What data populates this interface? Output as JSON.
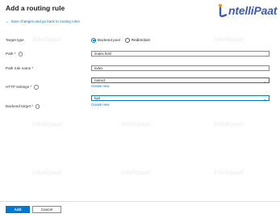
{
  "header": {
    "title": "Add a routing rule",
    "back_link": "Save changes and go back to routing rules"
  },
  "brand": {
    "text": "ntelliPaat",
    "watermark": "Intellipaat"
  },
  "form": {
    "target_type": {
      "label": "Target type",
      "options": [
        "Backend pool",
        "Redirection"
      ],
      "selected": "Backend pool"
    },
    "path": {
      "label": "Path *",
      "value": "/index.html"
    },
    "path_rule_name": {
      "label": "Path rule name *",
      "value": "index"
    },
    "http_settings": {
      "label": "HTTP settings *",
      "value": "name2",
      "create_new": "Create new"
    },
    "backend_target": {
      "label": "Backend target *",
      "value": "bp2",
      "create_new": "Create new"
    }
  },
  "footer": {
    "add": "Add",
    "cancel": "Cancel"
  },
  "colors": {
    "accent": "#0078d4",
    "brand": "#3f5aa6",
    "brand_orange": "#f7931e"
  }
}
